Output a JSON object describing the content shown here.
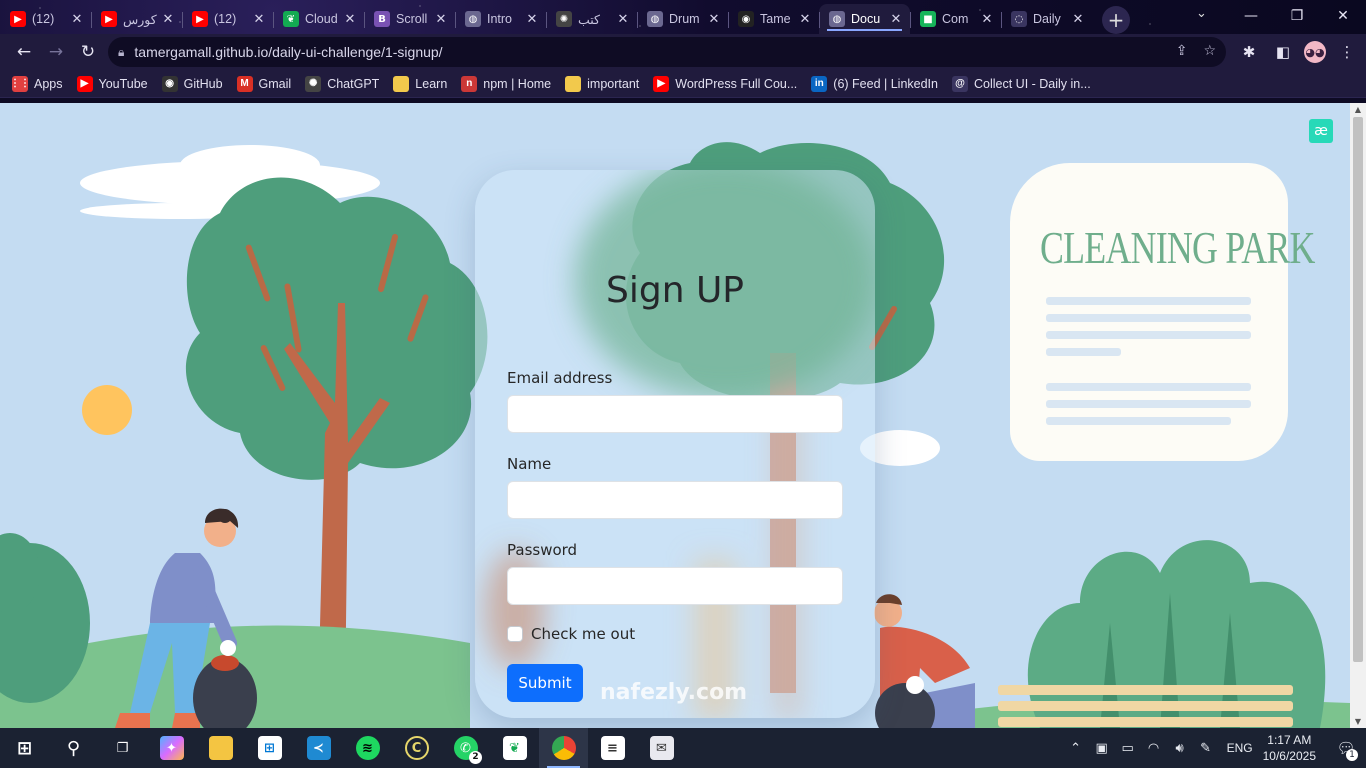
{
  "browser": {
    "tabs": [
      {
        "title": "(12)",
        "icon": "youtube-icon",
        "color": "#ff0000",
        "glyph": "▶"
      },
      {
        "title": "كورس",
        "icon": "youtube-icon",
        "color": "#ff0000",
        "glyph": "▶"
      },
      {
        "title": "(12)",
        "icon": "youtube-icon",
        "color": "#ff0000",
        "glyph": "▶"
      },
      {
        "title": "Cloud",
        "icon": "mongodb-leaf-icon",
        "color": "#13aa52",
        "glyph": "❦"
      },
      {
        "title": "Scroll",
        "icon": "bootstrap-icon",
        "color": "#7952b3",
        "glyph": "B"
      },
      {
        "title": "Intro",
        "icon": "globe-icon",
        "color": "#6b6890",
        "glyph": "◍"
      },
      {
        "title": "كتب",
        "icon": "chatgpt-icon",
        "color": "#444",
        "glyph": "✺"
      },
      {
        "title": "Drum",
        "icon": "globe-icon",
        "color": "#6b6890",
        "glyph": "◍"
      },
      {
        "title": "Tame",
        "icon": "github-icon",
        "color": "#222",
        "glyph": "◉"
      },
      {
        "title": "Docu",
        "icon": "globe-icon",
        "color": "#6b6890",
        "glyph": "◍",
        "active": true
      },
      {
        "title": "Com",
        "icon": "green-square-icon",
        "color": "#16b45a",
        "glyph": "■"
      },
      {
        "title": "Daily",
        "icon": "dribbble-icon",
        "color": "#3a3560",
        "glyph": "◌"
      }
    ],
    "url": "tamergamall.github.io/daily-ui-challenge/1-signup/",
    "bookmarks": [
      {
        "label": "Apps",
        "icon": "apps-grid-icon",
        "color": "#e04040",
        "glyph": "⋮⋮"
      },
      {
        "label": "YouTube",
        "icon": "youtube-icon",
        "color": "#ff0000",
        "glyph": "▶"
      },
      {
        "label": "GitHub",
        "icon": "github-icon",
        "color": "#333",
        "glyph": "◉"
      },
      {
        "label": "Gmail",
        "icon": "gmail-icon",
        "color": "#d93025",
        "glyph": "M"
      },
      {
        "label": "ChatGPT",
        "icon": "chatgpt-icon",
        "color": "#444",
        "glyph": "✺"
      },
      {
        "label": "Learn",
        "icon": "folder-icon",
        "color": "#f2c94c",
        "glyph": ""
      },
      {
        "label": "npm | Home",
        "icon": "npm-icon",
        "color": "#cb3837",
        "glyph": "n"
      },
      {
        "label": "important",
        "icon": "folder-icon",
        "color": "#f2c94c",
        "glyph": ""
      },
      {
        "label": "WordPress Full Cou...",
        "icon": "youtube-icon",
        "color": "#ff0000",
        "glyph": "▶"
      },
      {
        "label": "(6) Feed | LinkedIn",
        "icon": "linkedin-icon",
        "color": "#0a66c2",
        "glyph": "in"
      },
      {
        "label": "Collect UI - Daily in...",
        "icon": "collectui-icon",
        "color": "#3a3560",
        "glyph": "@"
      }
    ]
  },
  "page": {
    "cleaning_title": "CLEANING PARK",
    "signup": {
      "title": "Sign UP",
      "email_label": "Email address",
      "name_label": "Name",
      "password_label": "Password",
      "checkbox_label": "Check me out",
      "submit_label": "Submit"
    },
    "badge": "æ"
  },
  "watermark": "nafezly.com",
  "taskbar": {
    "whatsapp_count": "2",
    "language": "ENG",
    "time": "1:17 AM",
    "date": "10/6/2025",
    "notification_count": "1"
  }
}
